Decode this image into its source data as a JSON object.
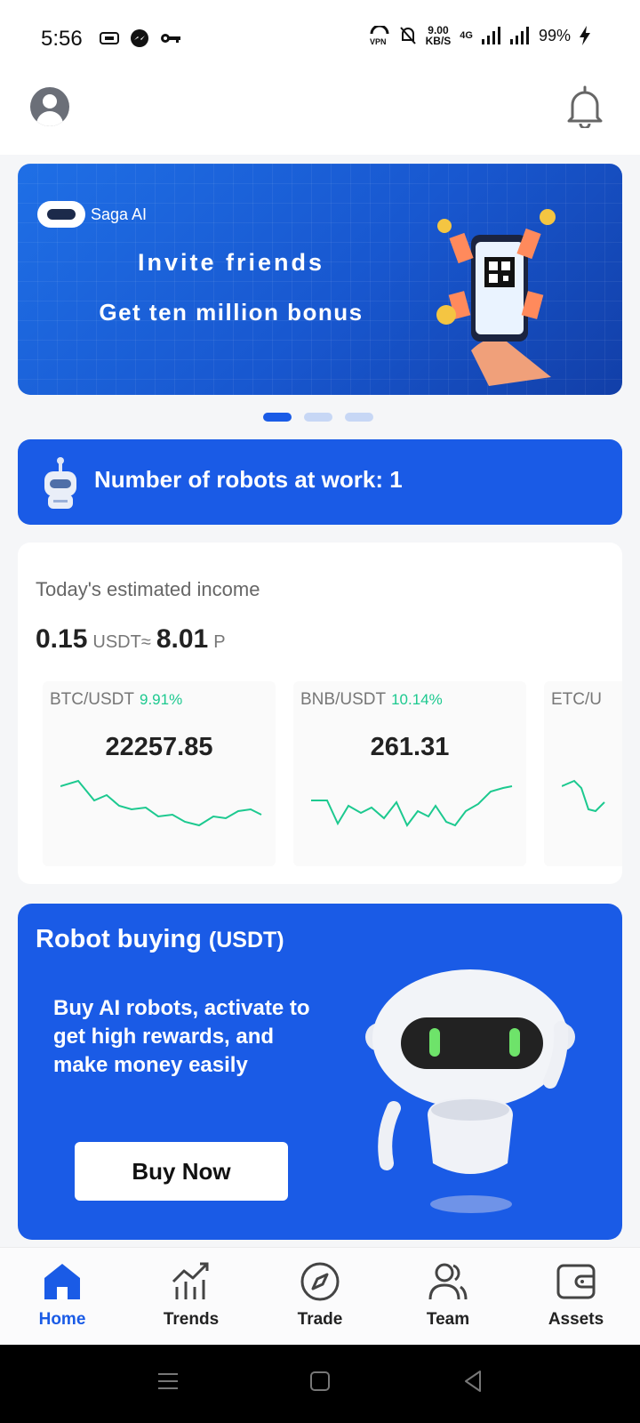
{
  "status_bar": {
    "time": "5:56",
    "net_speed_value": "9.00",
    "net_speed_unit": "KB/S",
    "network_type": "4G",
    "battery": "99%"
  },
  "banner": {
    "brand": "Saga AI",
    "line1": "Invite friends",
    "line2": "Get ten million bonus",
    "slides_count": 3,
    "active_slide": 0
  },
  "robots": {
    "label": "Number of robots at work: 1"
  },
  "income": {
    "label": "Today's estimated income",
    "usdt_value": "0.15",
    "usdt_unit": "USDT≈",
    "local_value": "8.01",
    "local_unit": "P",
    "tickers": [
      {
        "pair": "BTC/USDT",
        "change": "9.91%",
        "price": "22257.85"
      },
      {
        "pair": "BNB/USDT",
        "change": "10.14%",
        "price": "261.31"
      },
      {
        "pair": "ETC/U",
        "change": "",
        "price": ""
      }
    ]
  },
  "buy": {
    "title": "Robot buying",
    "title_unit": "(USDT)",
    "description": "Buy AI robots, activate to get high rewards, and make money easily",
    "button": "Buy Now"
  },
  "tabs": [
    {
      "label": "Home",
      "icon": "home-icon",
      "active": true
    },
    {
      "label": "Trends",
      "icon": "trends-icon",
      "active": false
    },
    {
      "label": "Trade",
      "icon": "compass-icon",
      "active": false
    },
    {
      "label": "Team",
      "icon": "team-icon",
      "active": false
    },
    {
      "label": "Assets",
      "icon": "wallet-icon",
      "active": false
    }
  ],
  "colors": {
    "primary": "#1a5be6",
    "positive": "#1cc98f"
  }
}
